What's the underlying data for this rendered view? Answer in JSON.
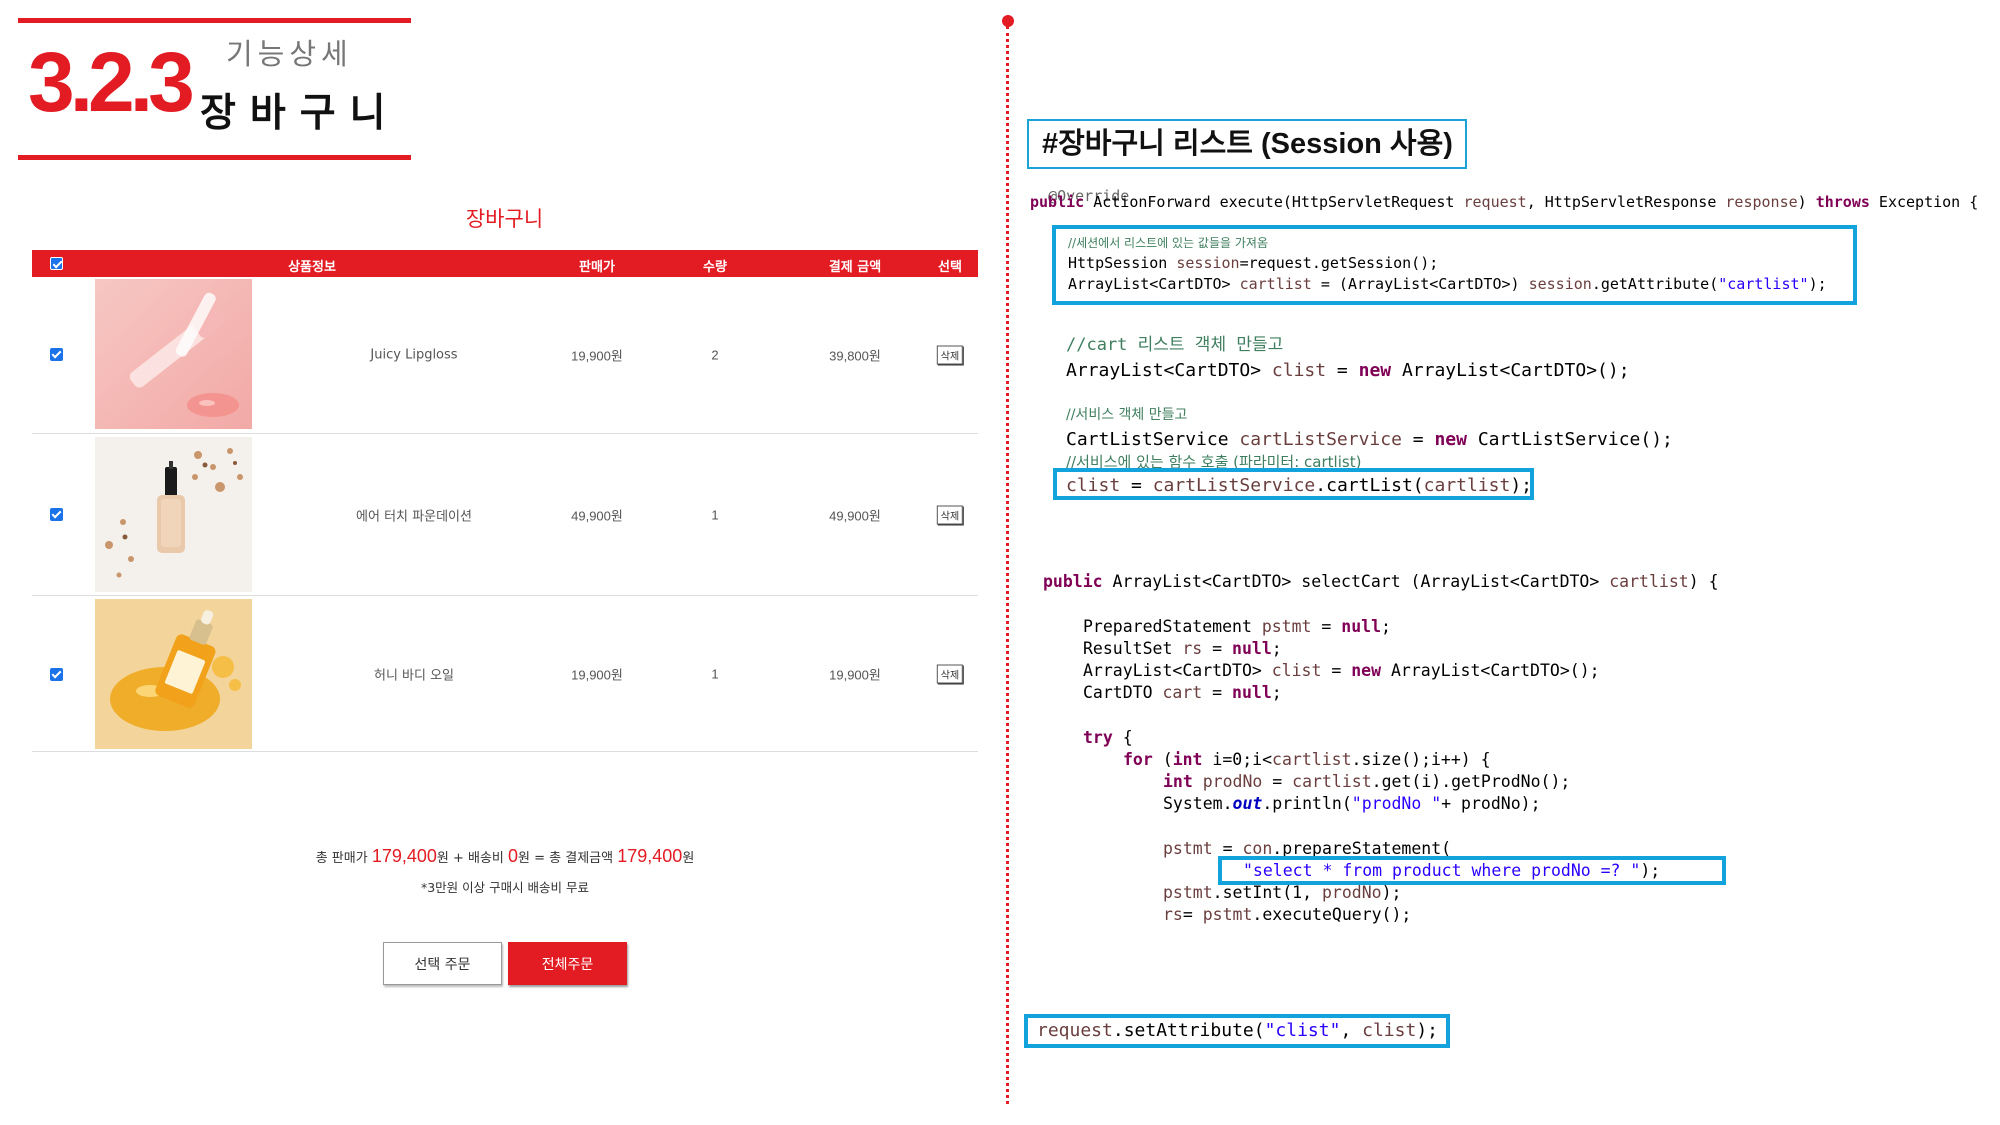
{
  "section": {
    "number": "3.2.3",
    "subtitle": "기능상세",
    "title": "장바구니"
  },
  "cart": {
    "heading": "장바구니",
    "columns": {
      "product": "상품정보",
      "price": "판매가",
      "qty": "수량",
      "total": "결제 금액",
      "select": "선택"
    },
    "items": [
      {
        "name": "Juicy Lipgloss",
        "price": "19,900원",
        "qty": "2",
        "total": "39,800원",
        "delete": "삭제",
        "checked": true
      },
      {
        "name": "에어 터치 파운데이션",
        "price": "49,900원",
        "qty": "1",
        "total": "49,900원",
        "delete": "삭제",
        "checked": true
      },
      {
        "name": "허니 바디 오일",
        "price": "19,900원",
        "qty": "1",
        "total": "19,900원",
        "delete": "삭제",
        "checked": true
      }
    ],
    "summary": {
      "label1": "총 판매가",
      "amount1": "179,400",
      "label2": "원 + 배송비",
      "amount2": "0",
      "label3": "원 = 총 결제금액",
      "amount3": "179,400",
      "label4": "원"
    },
    "note": "*3만원 이상 구매시 배송비 무료",
    "buttons": {
      "select_order": "선택 주문",
      "all_order": "전체주문"
    }
  },
  "code": {
    "title": "#장바구니 리스트 (Session 사용)",
    "override": "@Override",
    "method_sig": {
      "kw_public": "public",
      "rest1": " ActionForward execute(HttpServletRequest ",
      "p1": "request",
      "rest2": ", HttpServletResponse ",
      "p2": "response",
      "rest3": ") ",
      "kw_throws": "throws",
      "rest4": " Exception {"
    },
    "block1": {
      "comment": "//세션에서 리스트에 있는 값들을 가져옴",
      "l2_a": "HttpSession ",
      "l2_v": "session",
      "l2_b": "=request.getSession();",
      "l3_a": "ArrayList<CartDTO> ",
      "l3_v": "cartlist",
      "l3_b": " = (ArrayList<CartDTO>) ",
      "l3_v2": "session",
      "l3_c": ".getAttribute(",
      "l3_s": "\"cartlist\"",
      "l3_d": ");"
    },
    "block2": {
      "comment": "//cart 리스트 객체 만들고",
      "a": "ArrayList<CartDTO> ",
      "v": "clist",
      "b": " = ",
      "kw_new": "new",
      "c": " ArrayList<CartDTO>();"
    },
    "block3": {
      "comment": "//서비스 객체 만들고",
      "a": "CartListService ",
      "v": "cartListService",
      "b": " = ",
      "kw_new": "new",
      "c": " CartListService();",
      "comment2": "//서비스에 있는 함수 호출 (파라미터: cartlist)",
      "d_v": "clist",
      "d_b": " = ",
      "d_v2": "cartListService",
      "d_c": ".cartList(",
      "d_v3": "cartlist",
      "d_e": ");"
    },
    "select_cart": {
      "sig_kw": "public",
      "sig_a": " ArrayList<CartDTO> selectCart (ArrayList<CartDTO> ",
      "sig_v": "cartlist",
      "sig_b": ") {",
      "l1_a": "PreparedStatement ",
      "l1_v": "pstmt",
      "l1_b": " = ",
      "l1_k": "null",
      "l1_c": ";",
      "l2_a": "ResultSet ",
      "l2_v": "rs",
      "l2_b": " = ",
      "l2_k": "null",
      "l2_c": ";",
      "l3_a": "ArrayList<CartDTO> ",
      "l3_v": "clist",
      "l3_b": " = ",
      "l3_k": "new",
      "l3_c": " ArrayList<CartDTO>();",
      "l4_a": "CartDTO ",
      "l4_v": "cart",
      "l4_b": " = ",
      "l4_k": "null",
      "l4_c": ";",
      "try_k": "try",
      "try_b": " {",
      "for_k": "for",
      "for_a": " (",
      "for_k2": "int",
      "for_b": " i=0;i<",
      "for_v": "cartlist",
      "for_c": ".size();i++) {",
      "int_k": "int",
      "int_a": " ",
      "int_v": "prodNo",
      "int_b": " = ",
      "int_v2": "cartlist",
      "int_c": ".get(i).getProdNo();",
      "sys_a": "System.",
      "sys_f": "out",
      "sys_b": ".println(",
      "sys_s": "\"prodNo \"",
      "sys_c": "+ prodNo);",
      "ps_v": "pstmt",
      "ps_a": " = ",
      "ps_v2": "con",
      "ps_b": ".prepareStatement(",
      "sql": "\"select * from product where prodNo =? \"",
      "sql_end": ");",
      "setint_v": "pstmt",
      "setint_a": ".setInt(1, ",
      "setint_v2": "prodNo",
      "setint_b": ");",
      "rs_v": "rs",
      "rs_a": "= ",
      "rs_v2": "pstmt",
      "rs_b": ".executeQuery();"
    },
    "request_line": {
      "v": "request",
      "a": ".setAttribute(",
      "s": "\"clist\"",
      "b": ", ",
      "v2": "clist",
      "c": ");"
    }
  }
}
